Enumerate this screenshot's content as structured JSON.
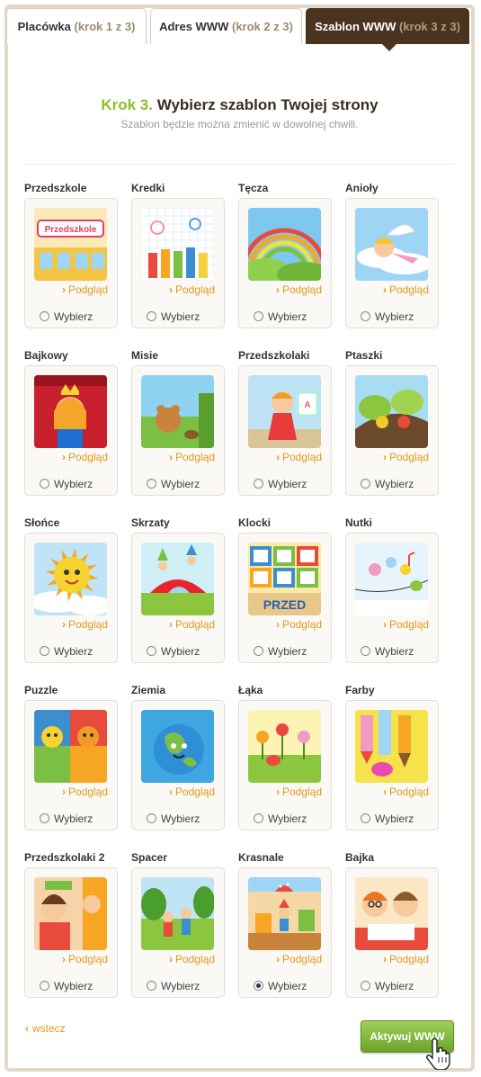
{
  "tabs": [
    {
      "label": "Placówka",
      "step": "(krok 1 z 3)"
    },
    {
      "label": "Adres WWW",
      "step": "(krok 2 z 3)"
    },
    {
      "label": "Szablon WWW",
      "step": "(krok 3 z 3)"
    }
  ],
  "header": {
    "krok": "Krok 3.",
    "title": "Wybierz szablon Twojej strony",
    "subtitle": "Szablon będzie można zmienić w dowolnej chwili."
  },
  "preview_label": "Podgląd",
  "select_label": "Wybierz",
  "templates": [
    {
      "name": "Przedszkole",
      "selected": false,
      "thumb_text": "Przedszkole"
    },
    {
      "name": "Kredki",
      "selected": false
    },
    {
      "name": "Tęcza",
      "selected": false
    },
    {
      "name": "Anioły",
      "selected": false
    },
    {
      "name": "Bajkowy",
      "selected": false
    },
    {
      "name": "Misie",
      "selected": false
    },
    {
      "name": "Przedszkolaki",
      "selected": false
    },
    {
      "name": "Ptaszki",
      "selected": false
    },
    {
      "name": "Słońce",
      "selected": false
    },
    {
      "name": "Skrzaty",
      "selected": false
    },
    {
      "name": "Klocki",
      "selected": false,
      "thumb_text": "PRZED"
    },
    {
      "name": "Nutki",
      "selected": false
    },
    {
      "name": "Puzzle",
      "selected": false
    },
    {
      "name": "Ziemia",
      "selected": false
    },
    {
      "name": "Łąka",
      "selected": false
    },
    {
      "name": "Farby",
      "selected": false
    },
    {
      "name": "Przedszkolaki 2",
      "selected": false
    },
    {
      "name": "Spacer",
      "selected": false
    },
    {
      "name": "Krasnale",
      "selected": true
    },
    {
      "name": "Bajka",
      "selected": false
    }
  ],
  "footer": {
    "back_label": "wstecz",
    "activate_label": "Aktywuj WWW"
  },
  "colors": {
    "accent_green": "#8bbf2e",
    "link_orange": "#e09a1e",
    "tab_active": "#4a3420"
  }
}
